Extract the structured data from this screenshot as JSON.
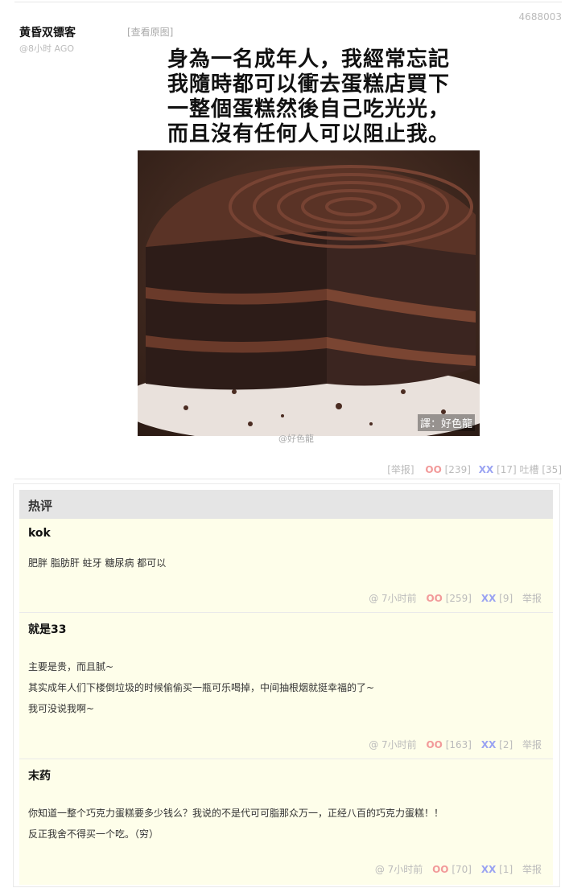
{
  "post": {
    "id": "4688003",
    "author": "黄昏双镖客",
    "time": "@8小时 AGO",
    "view_original": "[查看原图]",
    "image_text_lines": [
      "身為一名成年人，我經常忘記",
      "我隨時都可以衝去蛋糕店買下",
      "一整個蛋糕然後自己吃光光，",
      "而且沒有任何人可以阻止我。"
    ],
    "translator_credit": "譯：好色龍",
    "watermark": "@好色龍",
    "report": "[举报]",
    "oo": "OO",
    "oo_count": "[239]",
    "xx": "XX",
    "xx_count": "[17]",
    "tucao": "吐槽 [35]"
  },
  "hot_comments": {
    "title": "热评",
    "items": [
      {
        "name": "kok",
        "lines": [
          "肥胖 脂肪肝 蛀牙 糖尿病 都可以"
        ],
        "time": "@ 7小时前",
        "oo": "OO",
        "oo_count": "[259]",
        "xx": "XX",
        "xx_count": "[9]",
        "report": "举报"
      },
      {
        "name": "就是33",
        "lines": [
          "主要是贵，而且腻~",
          "其实成年人们下楼倒垃圾的时候偷偷买一瓶可乐喝掉，中间抽根烟就挺幸福的了~",
          "我可没说我啊~"
        ],
        "time": "@ 7小时前",
        "oo": "OO",
        "oo_count": "[163]",
        "xx": "XX",
        "xx_count": "[2]",
        "report": "举报"
      },
      {
        "name": "末药",
        "lines": [
          "你知道一整个巧克力蛋糕要多少钱么？我说的不是代可可脂那众万一，正经八百的巧克力蛋糕！！",
          "反正我舍不得买一个吃。（穷）"
        ],
        "time": "@ 7小时前",
        "oo": "OO",
        "oo_count": "[70]",
        "xx": "XX",
        "xx_count": "[1]",
        "report": "举报"
      }
    ]
  },
  "colors": {
    "oo": "#f29a9a",
    "xx": "#9aa3f2",
    "hot_bg": "#fefeea"
  }
}
